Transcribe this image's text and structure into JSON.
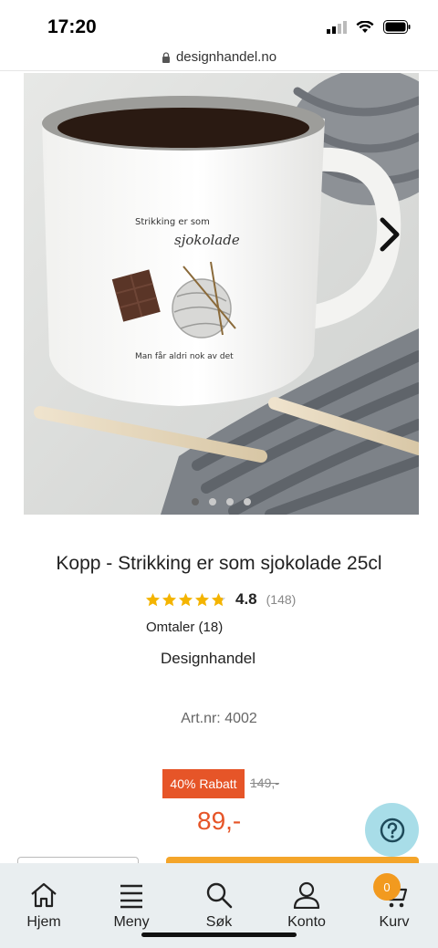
{
  "status_bar": {
    "time": "17:20"
  },
  "browser": {
    "url": "designhandel.no"
  },
  "product": {
    "image_alt": "Kopp med trykk",
    "mug_text_top": "Strikking er som",
    "mug_text_script": "sjokolade",
    "mug_text_bottom": "Man får aldri nok av det",
    "carousel": {
      "total": 4,
      "active": 1
    },
    "title": "Kopp - Strikking er som sjokolade 25cl",
    "rating": {
      "value": "4.8",
      "count": "(148)",
      "stars": 4.8
    },
    "reviews_link": "Omtaler (18)",
    "brand": "Designhandel",
    "article_number": "Art.nr: 4002",
    "discount_badge": "40% Rabatt",
    "old_price": "149,-",
    "price": "89,-"
  },
  "bottom_nav": {
    "items": [
      {
        "label": "Hjem",
        "icon": "home-icon"
      },
      {
        "label": "Meny",
        "icon": "menu-icon"
      },
      {
        "label": "Søk",
        "icon": "search-icon"
      },
      {
        "label": "Konto",
        "icon": "account-icon"
      },
      {
        "label": "Kurv",
        "icon": "cart-icon"
      }
    ],
    "cart_count": "0"
  },
  "colors": {
    "accent": "#e65528",
    "cta": "#f4a52a",
    "star": "#f4b400",
    "help_bg": "#a8dde8",
    "nav_bg": "#e9eef0"
  }
}
